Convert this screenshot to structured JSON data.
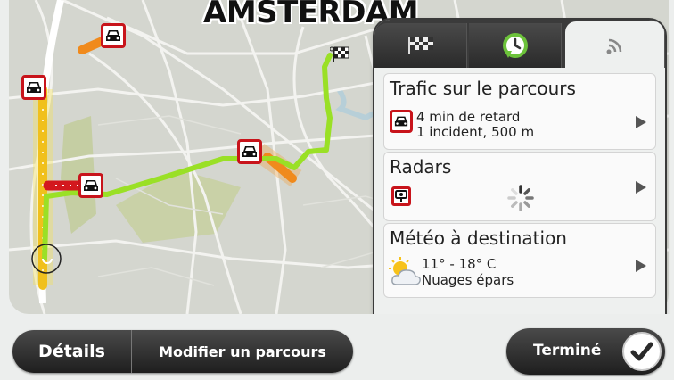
{
  "map": {
    "city_label": "AMSTERDAM",
    "icons": [
      "traffic-jam-icon",
      "checkered-flag-icon",
      "current-position-icon"
    ]
  },
  "panel": {
    "tabs": [
      {
        "icon": "checkered-flag-icon"
      },
      {
        "icon": "clock-arrow-icon"
      },
      {
        "icon": "signal-waves-icon"
      }
    ],
    "traffic": {
      "title": "Trafic sur le parcours",
      "delay": "4 min de retard",
      "incidents": "1 incident, 500 m"
    },
    "radars": {
      "title": "Radars"
    },
    "weather": {
      "title": "Météo à destination",
      "temperature": "11° - 18° C",
      "condition": "Nuages épars"
    }
  },
  "bottom": {
    "details_label": "Détails",
    "modify_label": "Modifier un parcours",
    "done_label": "Terminé"
  },
  "colors": {
    "route_green": "#9ae026",
    "traffic_red": "#c8141b",
    "traffic_orange": "#f08a1c",
    "map_bg": "#d4d6cf",
    "park_green": "#c5cea3"
  }
}
